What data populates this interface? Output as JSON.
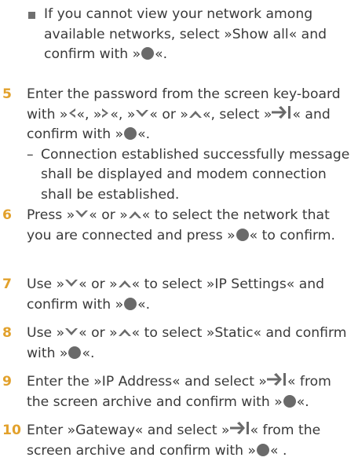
{
  "bullet": {
    "text_before": "If you cannot view your network among available networks, select »Show all« and confirm with »",
    "text_after": "«."
  },
  "steps": [
    {
      "number": "5",
      "p1": "Enter the password from the screen key-board with »",
      "p2": "«, »",
      "p3": "«, »",
      "p4": "« or »",
      "p5": "«, select »",
      "p6": "« and confirm with »",
      "p7": "«.",
      "sub": "Connection established successfully message shall be displayed and modem connection shall be established."
    },
    {
      "number": "6",
      "p1": "Press »",
      "p2": "« or »",
      "p3": "« to select the network that you are connected and press »",
      "p4": "« to confirm."
    },
    {
      "number": "7",
      "p1": "Use »",
      "p2": "« or »",
      "p3": "« to select »IP Settings« and confirm with »",
      "p4": "«."
    },
    {
      "number": "8",
      "p1": "Use »",
      "p2": "« or »",
      "p3": "« to select »Static« and confirm with »",
      "p4": "«."
    },
    {
      "number": "9",
      "p1": "Enter the »IP Address« and select »",
      "p2": "« from the screen archive and confirm with »",
      "p3": "«."
    },
    {
      "number": "10",
      "p1": "Enter »Gateway« and select »",
      "p2": "« from the screen archive and confirm with »",
      "p3": "« ."
    }
  ],
  "icons": {
    "ok": "ok-button-icon",
    "left": "left-arrow-icon",
    "right": "right-arrow-icon",
    "down": "down-arrow-icon",
    "up": "up-arrow-icon",
    "tab": "tab-arrow-icon",
    "icon_color": "#6a6a6a",
    "number_color": "#e2a12c"
  }
}
